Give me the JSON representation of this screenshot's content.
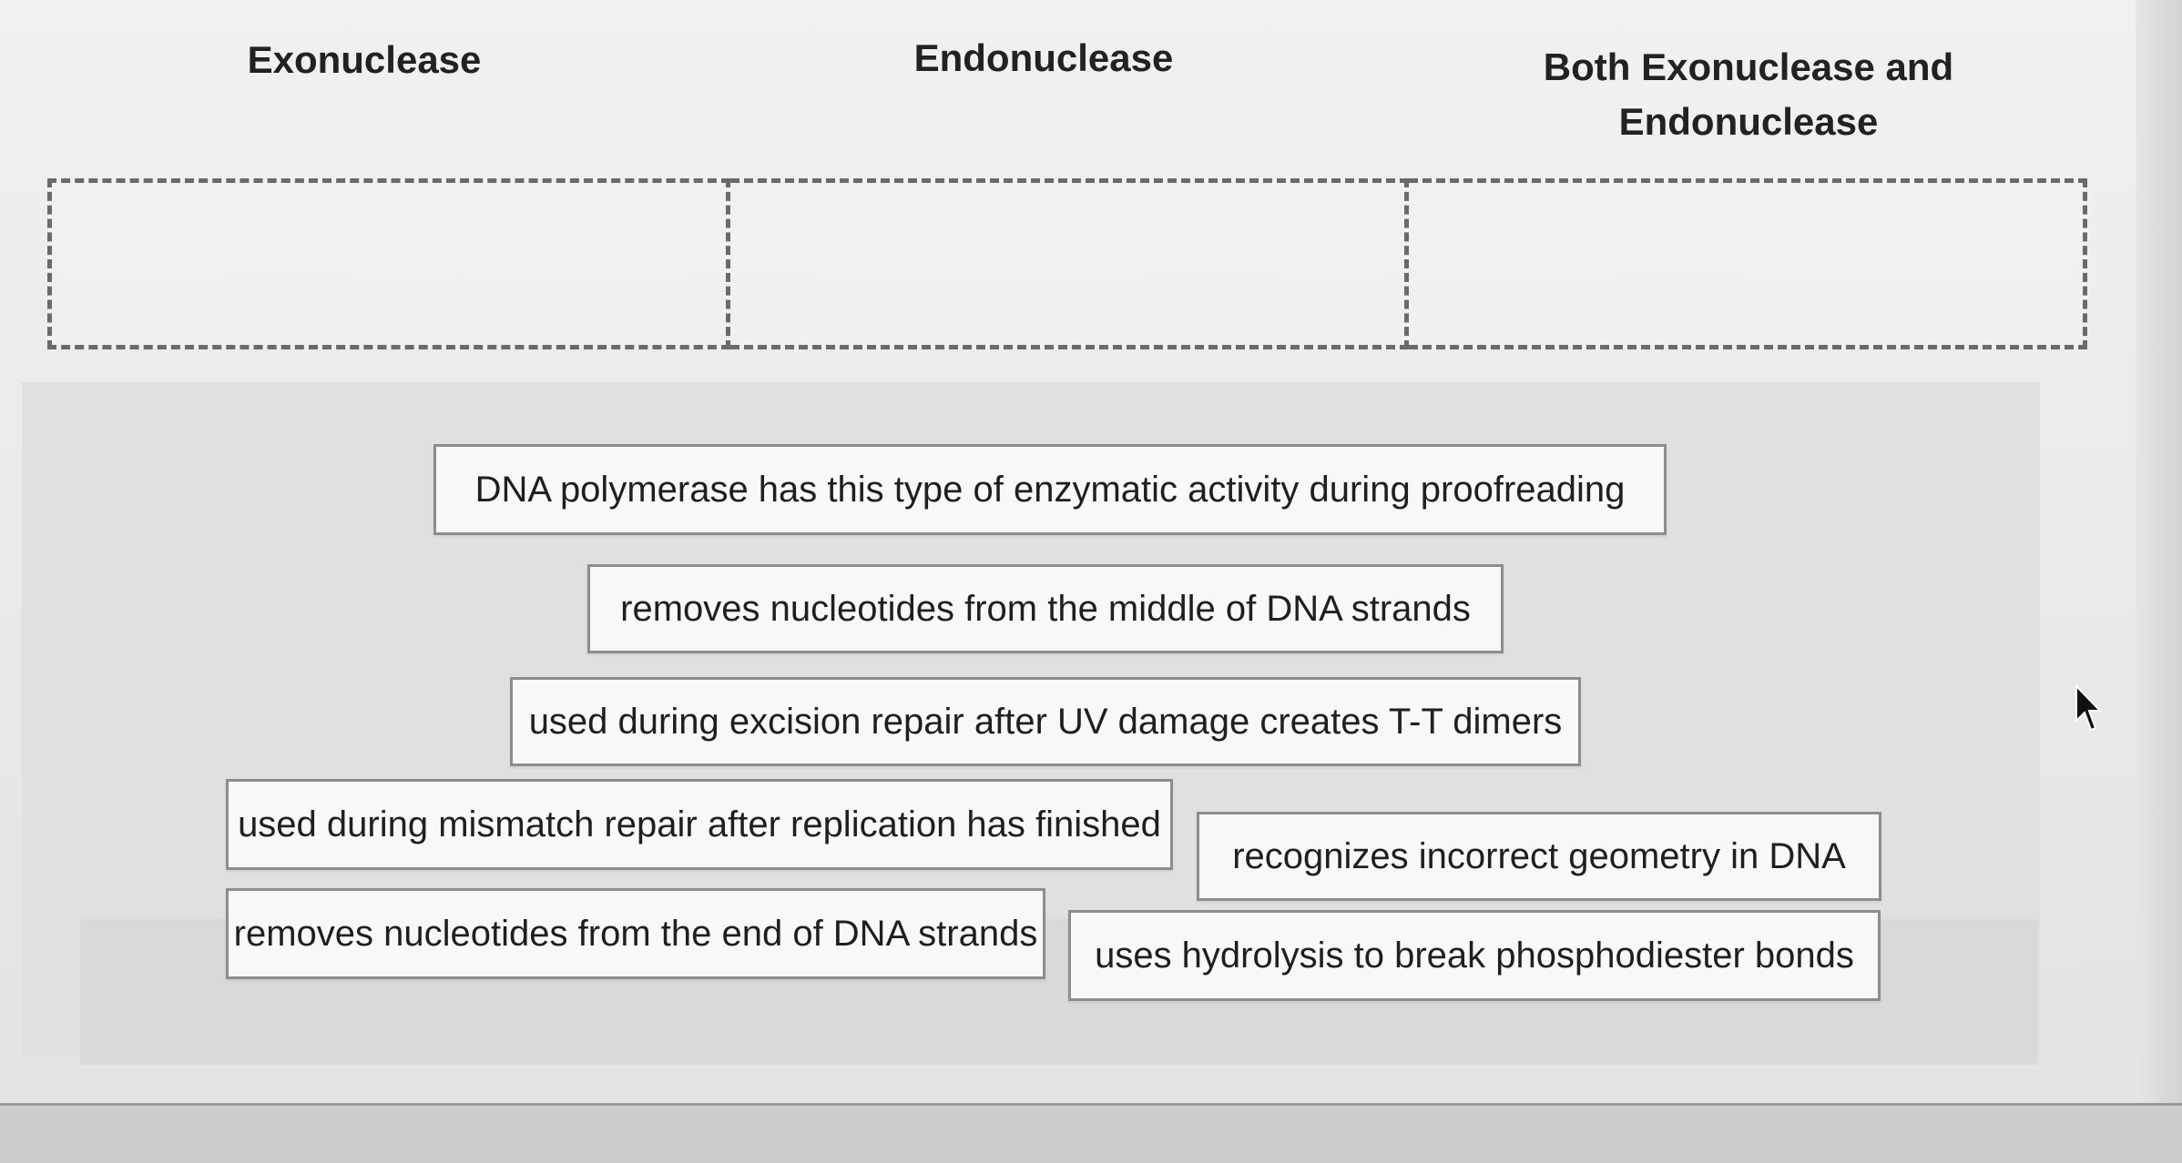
{
  "columns": [
    {
      "header": "Exonuclease"
    },
    {
      "header": "Endonuclease"
    },
    {
      "header_line1": "Both Exonuclease and",
      "header_line2": "Endonuclease"
    }
  ],
  "answer_tiles": [
    "DNA polymerase has this type of enzymatic activity during proofreading",
    "removes nucleotides from the middle of DNA strands",
    "used during excision repair after UV damage creates T-T dimers",
    "used during mismatch repair after replication has finished",
    "recognizes incorrect geometry in DNA",
    "removes nucleotides from the end of DNA strands",
    "uses hydrolysis to break phosphodiester bonds"
  ],
  "icons": {
    "cursor": "mouse-pointer-icon"
  }
}
